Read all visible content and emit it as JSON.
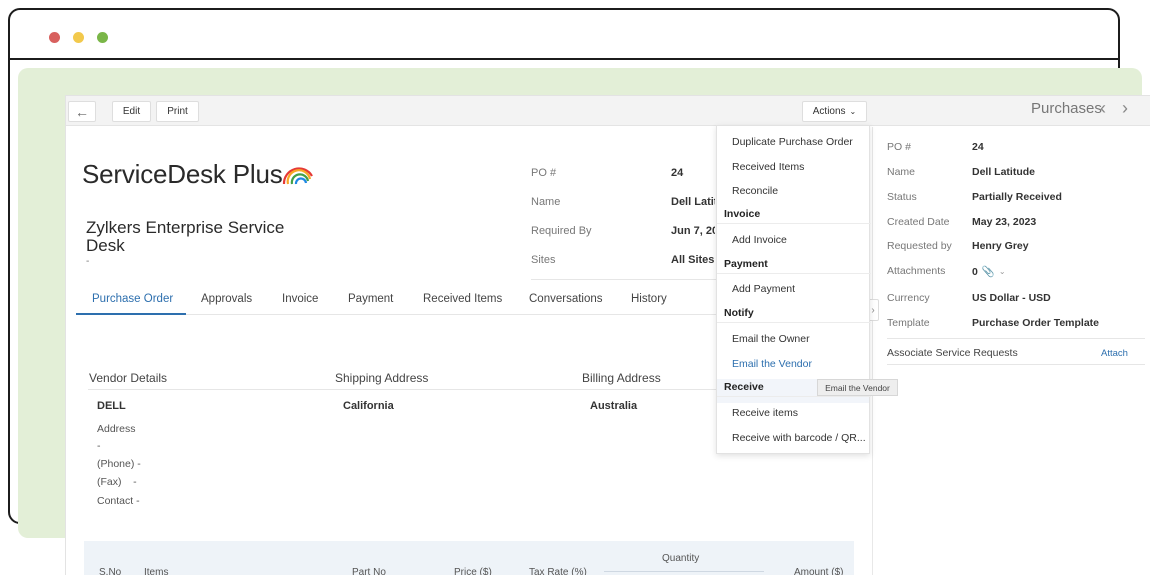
{
  "toolbar": {
    "edit_label": "Edit",
    "print_label": "Print",
    "actions_label": "Actions",
    "module_title": "Purchases"
  },
  "header": {
    "logo_text": "ServiceDesk Plus",
    "org_name": "Zylkers Enterprise Service Desk",
    "org_sub": "-"
  },
  "po_summary": [
    {
      "label": "PO #",
      "value": "24"
    },
    {
      "label": "Name",
      "value": "Dell Latitude"
    },
    {
      "label": "Required By",
      "value": "Jun 7, 2023"
    },
    {
      "label": "Sites",
      "value": "All Sites"
    }
  ],
  "tabs": [
    {
      "label": "Purchase Order",
      "active": true
    },
    {
      "label": "Approvals"
    },
    {
      "label": "Invoice"
    },
    {
      "label": "Payment"
    },
    {
      "label": "Received Items"
    },
    {
      "label": "Conversations"
    },
    {
      "label": "History"
    }
  ],
  "addresses": {
    "vendor": {
      "heading": "Vendor Details",
      "name": "DELL"
    },
    "shipping": {
      "heading": "Shipping Address",
      "name": "California"
    },
    "billing": {
      "heading": "Billing Address",
      "name": "Australia"
    }
  },
  "vendor_details": {
    "address_label": "Address",
    "address_value": "-",
    "phone": "(Phone) -",
    "fax": "(Fax)    -",
    "contact": "Contact -"
  },
  "items_table": {
    "quantity_group": "Quantity",
    "columns": [
      "S.No",
      "Items",
      "Part No",
      "Price ($)",
      "Tax Rate (%)",
      "Amount ($)"
    ]
  },
  "actions_menu": {
    "items_top": [
      "Duplicate Purchase Order",
      "Received Items",
      "Reconcile"
    ],
    "invoice_heading": "Invoice",
    "invoice_items": [
      "Add Invoice"
    ],
    "payment_heading": "Payment",
    "payment_items": [
      "Add Payment"
    ],
    "notify_heading": "Notify",
    "notify_items": [
      "Email the Owner",
      "Email the Vendor"
    ],
    "receive_heading": "Receive",
    "receive_items": [
      "Receive items",
      "Receive with barcode / QR..."
    ]
  },
  "tooltip": "Email the Vendor",
  "details_panel": {
    "fields": [
      {
        "label": "PO #",
        "value": "24"
      },
      {
        "label": "Name",
        "value": "Dell Latitude"
      },
      {
        "label": "Status",
        "value": "Partially Received"
      },
      {
        "label": "Created Date",
        "value": "May 23, 2023"
      },
      {
        "label": "Requested by",
        "value": "Henry Grey"
      }
    ],
    "attachments_label": "Attachments",
    "attachments_count": "0",
    "currency_label": "Currency",
    "currency_value": "US Dollar - USD",
    "template_label": "Template",
    "template_value": "Purchase Order Template",
    "associate_label": "Associate Service Requests",
    "attach_link": "Attach"
  },
  "colors": {
    "accent": "#2d6fae",
    "frame_green": "#e3efd7"
  }
}
